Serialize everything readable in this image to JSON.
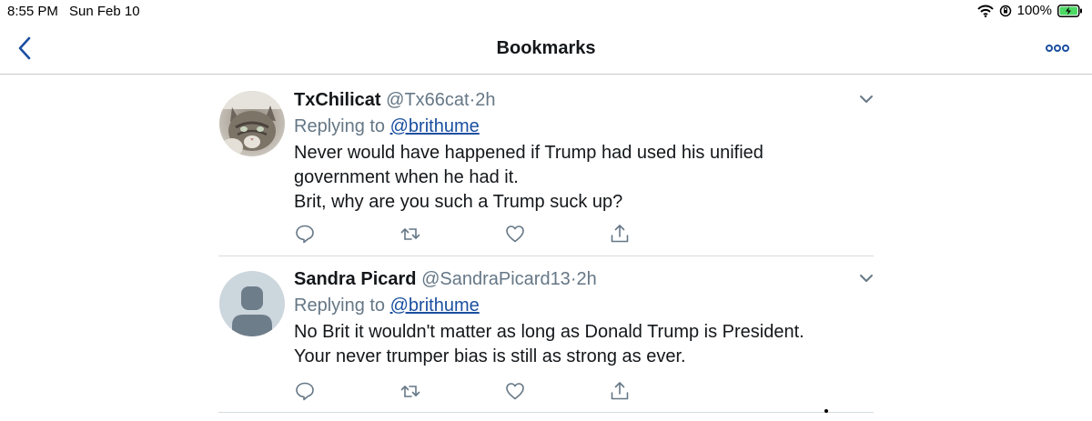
{
  "status_bar": {
    "time": "8:55 PM",
    "date": "Sun Feb 10",
    "battery": "100%",
    "icons": [
      "wifi-icon",
      "orientation-lock-icon",
      "battery-charging-icon"
    ],
    "battery_color": "#4cd964"
  },
  "nav": {
    "title": "Bookmarks",
    "back_icon": "chevron-left-icon",
    "more_icon": "more-dots-icon",
    "accent": "#1b4fa0"
  },
  "tweets": [
    {
      "display_name": "TxChilicat",
      "handle": "@Tx66cat",
      "separator": "·",
      "time": "2h",
      "replying_prefix": "Replying to",
      "replying_to": "@brithume",
      "text_lines": [
        "Never would have happened if Trump had used his unified government when he had it.",
        "Brit, why are you such a Trump suck up?"
      ],
      "avatar": "cat-photo"
    },
    {
      "display_name": "Sandra Picard",
      "handle": "@SandraPicard13",
      "separator": "·",
      "time": "2h",
      "replying_prefix": "Replying to",
      "replying_to": "@brithume",
      "text_lines": [
        "No Brit it wouldn't matter as long as Donald Trump is President. Your never trumper bias is still as strong as ever."
      ],
      "avatar": "default-avatar"
    }
  ],
  "action_icons": [
    "reply-icon",
    "retweet-icon",
    "like-icon",
    "share-icon"
  ]
}
